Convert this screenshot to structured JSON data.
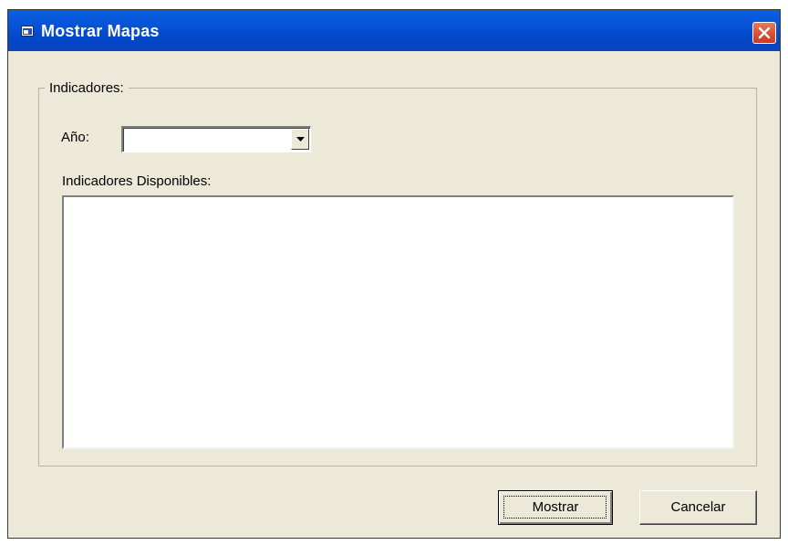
{
  "window": {
    "title": "Mostrar Mapas",
    "icon": "window-map-icon",
    "close_icon": "close-icon"
  },
  "group": {
    "legend": "Indicadores:"
  },
  "year": {
    "label": "Año:",
    "value": "",
    "arrow_icon": "chevron-down-icon"
  },
  "available": {
    "label": "Indicadores Disponibles:",
    "items": []
  },
  "buttons": {
    "show_label": "Mostrar",
    "cancel_label": "Cancelar"
  },
  "colors": {
    "titlebar": "#0652d6",
    "dialog_bg": "#ece9d8",
    "close_button": "#d8553a"
  }
}
